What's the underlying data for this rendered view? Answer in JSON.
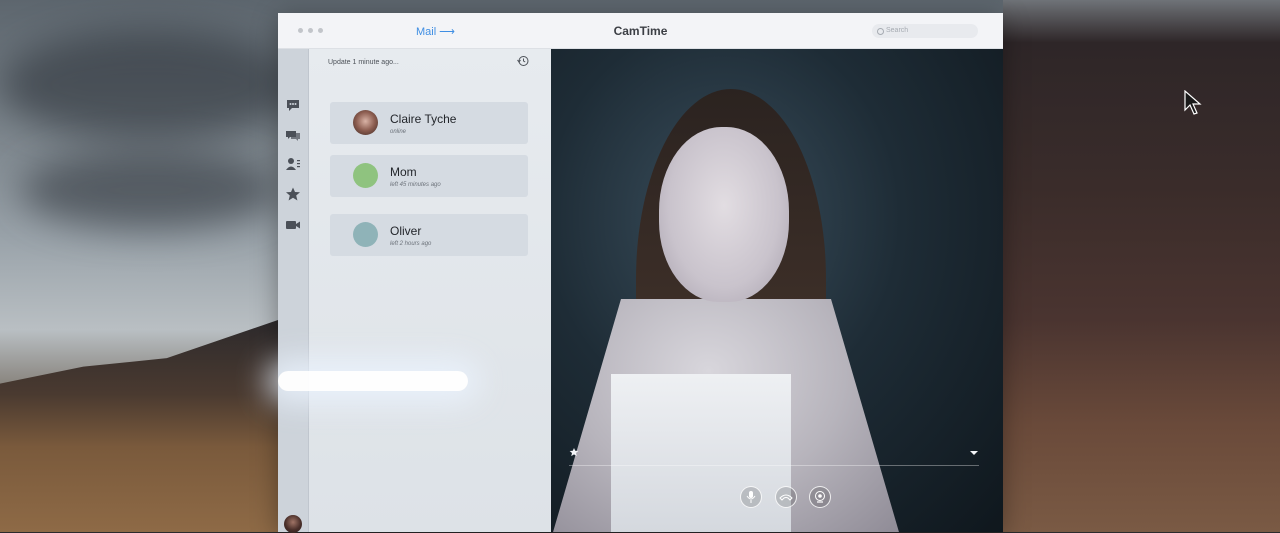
{
  "titlebar": {
    "mail_label": "Mail",
    "mail_arrow": "⟶",
    "app_title": "CamTime",
    "search_placeholder": "Search"
  },
  "rail": {
    "icons": [
      "chat-icon",
      "group-chat-icon",
      "contacts-icon",
      "star-icon",
      "video-icon"
    ]
  },
  "contacts_panel": {
    "update_text": "Update 1 minute ago...",
    "contacts": [
      {
        "name": "Claire Tyche",
        "status": "online",
        "avatar": "photo"
      },
      {
        "name": "Mom",
        "status": "left 45 minutes ago",
        "avatar_color": "#8fc37f"
      },
      {
        "name": "Oliver",
        "status": "left 2 hours ago",
        "avatar_color": "#8fb3b8"
      }
    ]
  },
  "video": {
    "controls": [
      "microphone-icon",
      "hang-up-icon",
      "camera-icon"
    ]
  },
  "colors": {
    "accent": "#3f8ee3",
    "rail_bg": "#cdd3da",
    "panel_bg": "#e7ebef"
  }
}
